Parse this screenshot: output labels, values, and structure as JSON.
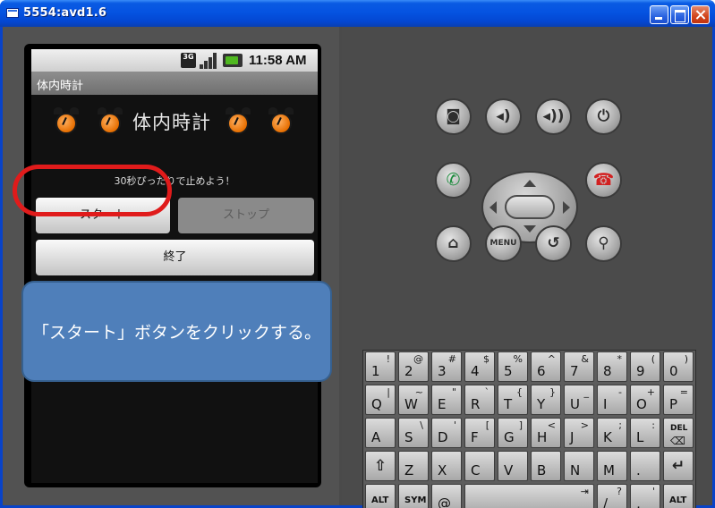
{
  "window": {
    "title": "5554:avd1.6"
  },
  "status_bar": {
    "network_label": "3G",
    "time": "11:58 AM"
  },
  "app": {
    "title_bar": "体内時計",
    "big_title": "体内時計",
    "instruction": "30秒ぴったりで止めよう！",
    "start_button": "スタート",
    "stop_button": "ストップ",
    "end_button": "終了"
  },
  "callout": {
    "text": "「スタート」ボタンをクリックする。"
  },
  "hardware": {
    "menu_label": "MENU"
  },
  "keyboard": {
    "row1": [
      {
        "main": "1",
        "sub": "!"
      },
      {
        "main": "2",
        "sub": "@"
      },
      {
        "main": "3",
        "sub": "#"
      },
      {
        "main": "4",
        "sub": "$"
      },
      {
        "main": "5",
        "sub": "%"
      },
      {
        "main": "6",
        "sub": "^"
      },
      {
        "main": "7",
        "sub": "&"
      },
      {
        "main": "8",
        "sub": "*"
      },
      {
        "main": "9",
        "sub": "("
      },
      {
        "main": "0",
        "sub": ")"
      }
    ],
    "row2": [
      {
        "main": "Q",
        "sub": "|"
      },
      {
        "main": "W",
        "sub": "~"
      },
      {
        "main": "E",
        "sub": "\""
      },
      {
        "main": "R",
        "sub": "`"
      },
      {
        "main": "T",
        "sub": "{"
      },
      {
        "main": "Y",
        "sub": "}"
      },
      {
        "main": "U",
        "sub": "_"
      },
      {
        "main": "I",
        "sub": "-"
      },
      {
        "main": "O",
        "sub": "+"
      },
      {
        "main": "P",
        "sub": "="
      }
    ],
    "row3": [
      {
        "main": "A",
        "sub": ""
      },
      {
        "main": "S",
        "sub": "\\"
      },
      {
        "main": "D",
        "sub": "'"
      },
      {
        "main": "F",
        "sub": "["
      },
      {
        "main": "G",
        "sub": "]"
      },
      {
        "main": "H",
        "sub": "<"
      },
      {
        "main": "J",
        "sub": ">"
      },
      {
        "main": "K",
        "sub": ";"
      },
      {
        "main": "L",
        "sub": ":"
      },
      {
        "main": "DEL",
        "sub": "⌫"
      }
    ],
    "row4": [
      {
        "main": "⇧",
        "sub": ""
      },
      {
        "main": "Z",
        "sub": ""
      },
      {
        "main": "X",
        "sub": ""
      },
      {
        "main": "C",
        "sub": ""
      },
      {
        "main": "V",
        "sub": ""
      },
      {
        "main": "B",
        "sub": ""
      },
      {
        "main": "N",
        "sub": ""
      },
      {
        "main": "M",
        "sub": ""
      },
      {
        "main": ".",
        "sub": ""
      },
      {
        "main": "↵",
        "sub": ""
      }
    ],
    "row5": {
      "alt_left": "ALT",
      "sym": "SYM",
      "at": "@",
      "space_sub": "⇥",
      "space_main": "⎵",
      "slash_main": "/",
      "slash_sub": "?",
      "comma_main": ",",
      "comma_sub": "'",
      "alt_right": "ALT"
    }
  }
}
